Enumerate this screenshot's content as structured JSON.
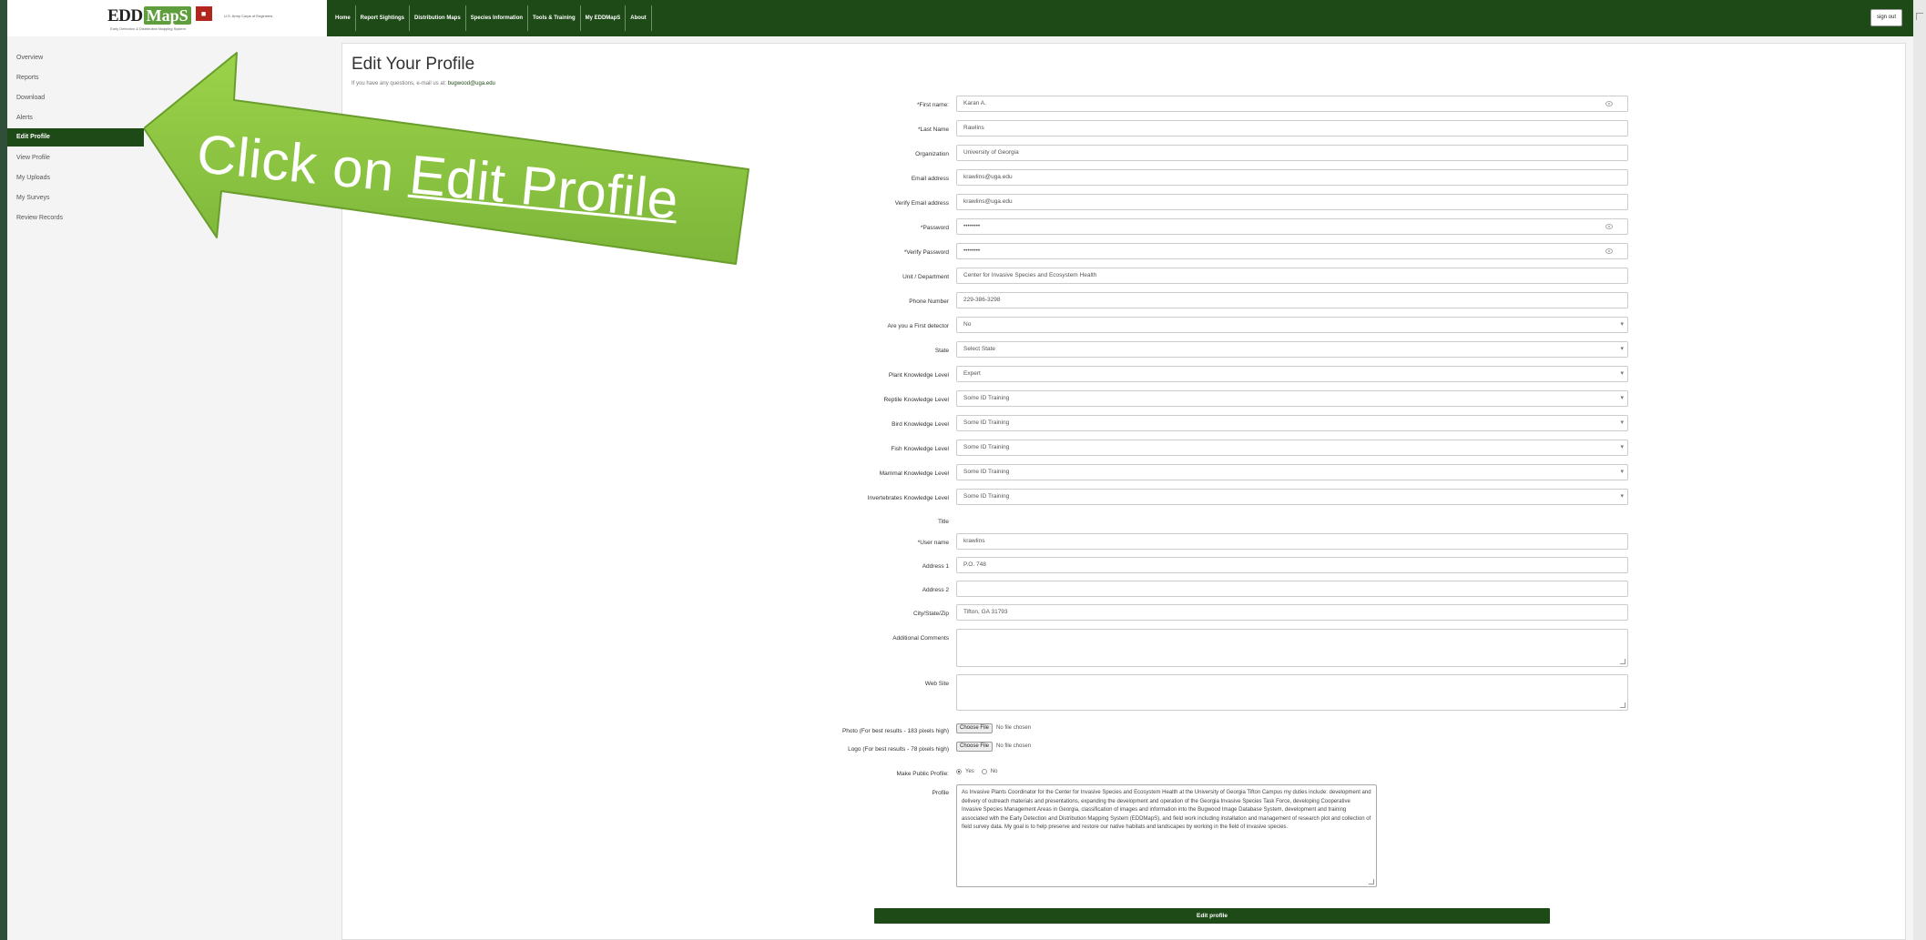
{
  "header": {
    "logo": {
      "edd": "EDD",
      "maps": "MapS",
      "tagline": "Early Detection & Distribution Mapping System",
      "usace": "U.S. Army Corps of Engineers",
      "badge": "",
      "badge_color": "#b3261e",
      "accent_color": "#5f9e3c"
    },
    "nav": [
      "Home",
      "Report Sightings",
      "Distribution Maps",
      "Species Information",
      "Tools & Training",
      "My EDDMapS",
      "About"
    ],
    "sign_out": "sign out",
    "nav_color": "#1e4a17"
  },
  "sidebar": {
    "items": [
      "Overview",
      "Reports",
      "Download",
      "Alerts",
      "Edit Profile",
      "View Profile",
      "My Uploads",
      "My Surveys",
      "Review Records"
    ],
    "active": "Edit Profile"
  },
  "main": {
    "title": "Edit Your Profile",
    "subtitle_prefix": "If you have any questions, e-mail us at:",
    "subtitle_email": "bugwood@uga.edu",
    "fields": [
      {
        "label": "*First name:",
        "value": "Karan A."
      },
      {
        "label": "*Last Name",
        "value": "Rawlins"
      },
      {
        "label": "Organization",
        "value": "University of Georgia"
      },
      {
        "label": "Email address",
        "value": "krawlins@uga.edu"
      },
      {
        "label": "Verify Email address",
        "value": "krawlins@uga.edu"
      },
      {
        "label": "*Password",
        "value": "••••••••"
      },
      {
        "label": "*Verify Password",
        "value": "••••••••"
      },
      {
        "label": "Unit / Department",
        "value": "Center for Invasive Species and Ecosystem Health"
      },
      {
        "label": "Phone Number",
        "value": "229-386-3298"
      },
      {
        "label": "Are you a First detector",
        "value": "No"
      },
      {
        "label": "State",
        "value": "Select State"
      },
      {
        "label": "Plant Knowledge Level",
        "value": "Expert"
      },
      {
        "label": "Reptile Knowledge Level",
        "value": "Some ID Training"
      },
      {
        "label": "Bird Knowledge Level",
        "value": "Some ID Training"
      },
      {
        "label": "Fish Knowledge Level",
        "value": "Some ID Training"
      },
      {
        "label": "Mammal Knowledge Level",
        "value": "Some ID Training"
      },
      {
        "label": "Invertebrates Knowledge Level",
        "value": "Some ID Training"
      },
      {
        "label": "Title",
        "value": ""
      },
      {
        "label": "*User name",
        "value": "krawlins"
      },
      {
        "label": "Address 1",
        "value": "P.O. 748"
      },
      {
        "label": "Address 2",
        "value": ""
      },
      {
        "label": "City/State/Zip",
        "value": "Tifton, GA 31793"
      }
    ],
    "additional_comments_label": "Additional Comments",
    "website_label": "Web Site",
    "photo_label": "Photo (For best results - 183 pixels high)",
    "logo_label": "Logo (For best results - 78 pixels high)",
    "choose_file": "Choose File",
    "no_file": "No file chosen",
    "public_label": "Make Public Profile:",
    "public_yes": "Yes",
    "public_no": "No",
    "public_selected": "Yes",
    "profile_label": "Profile",
    "profile_text": "As Invasive Plants Coordinator for the Center for Invasive Species and Ecosystem Health at the University of Georgia Tifton Campus my duties include: development and delivery of outreach materials and presentations, expanding the development and operation of the Georgia Invasive Species Task Force, developing Cooperative Invasive Species Management Areas in Georgia, classification of images and information into the Bugwood Image Database System, development and training associated with the Early Detection and Distribution Mapping System (EDDMapS), and field work including installation and management of research plot and collection of field survey data. My goal is to help preserve and restore our native habitats and landscapes by working in the field of invasive species.",
    "submit": "Edit profile"
  },
  "callout": {
    "text_prefix": "Click on ",
    "text_link": "Edit Profile",
    "color": "#8dc63f"
  }
}
